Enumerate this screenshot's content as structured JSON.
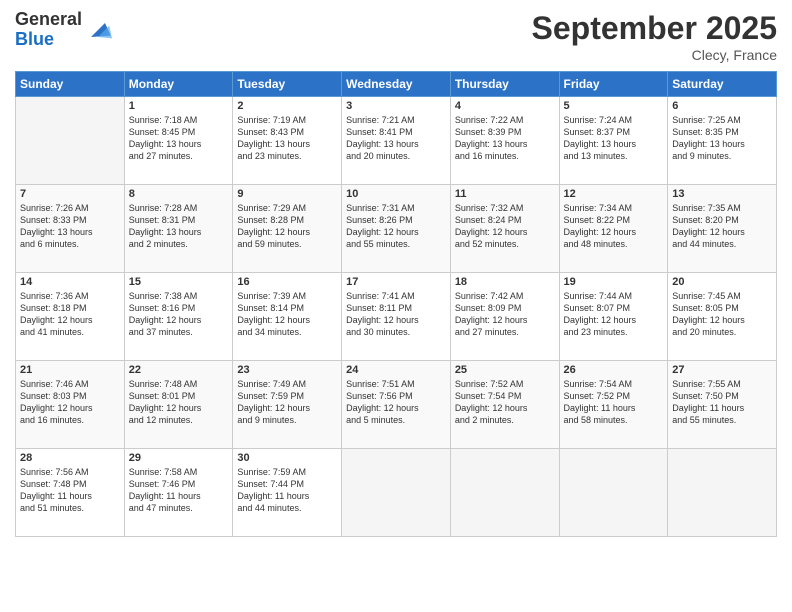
{
  "logo": {
    "general": "General",
    "blue": "Blue"
  },
  "header": {
    "month": "September 2025",
    "location": "Clecy, France"
  },
  "weekdays": [
    "Sunday",
    "Monday",
    "Tuesday",
    "Wednesday",
    "Thursday",
    "Friday",
    "Saturday"
  ],
  "weeks": [
    [
      {
        "day": "",
        "info": ""
      },
      {
        "day": "1",
        "info": "Sunrise: 7:18 AM\nSunset: 8:45 PM\nDaylight: 13 hours\nand 27 minutes."
      },
      {
        "day": "2",
        "info": "Sunrise: 7:19 AM\nSunset: 8:43 PM\nDaylight: 13 hours\nand 23 minutes."
      },
      {
        "day": "3",
        "info": "Sunrise: 7:21 AM\nSunset: 8:41 PM\nDaylight: 13 hours\nand 20 minutes."
      },
      {
        "day": "4",
        "info": "Sunrise: 7:22 AM\nSunset: 8:39 PM\nDaylight: 13 hours\nand 16 minutes."
      },
      {
        "day": "5",
        "info": "Sunrise: 7:24 AM\nSunset: 8:37 PM\nDaylight: 13 hours\nand 13 minutes."
      },
      {
        "day": "6",
        "info": "Sunrise: 7:25 AM\nSunset: 8:35 PM\nDaylight: 13 hours\nand 9 minutes."
      }
    ],
    [
      {
        "day": "7",
        "info": "Sunrise: 7:26 AM\nSunset: 8:33 PM\nDaylight: 13 hours\nand 6 minutes."
      },
      {
        "day": "8",
        "info": "Sunrise: 7:28 AM\nSunset: 8:31 PM\nDaylight: 13 hours\nand 2 minutes."
      },
      {
        "day": "9",
        "info": "Sunrise: 7:29 AM\nSunset: 8:28 PM\nDaylight: 12 hours\nand 59 minutes."
      },
      {
        "day": "10",
        "info": "Sunrise: 7:31 AM\nSunset: 8:26 PM\nDaylight: 12 hours\nand 55 minutes."
      },
      {
        "day": "11",
        "info": "Sunrise: 7:32 AM\nSunset: 8:24 PM\nDaylight: 12 hours\nand 52 minutes."
      },
      {
        "day": "12",
        "info": "Sunrise: 7:34 AM\nSunset: 8:22 PM\nDaylight: 12 hours\nand 48 minutes."
      },
      {
        "day": "13",
        "info": "Sunrise: 7:35 AM\nSunset: 8:20 PM\nDaylight: 12 hours\nand 44 minutes."
      }
    ],
    [
      {
        "day": "14",
        "info": "Sunrise: 7:36 AM\nSunset: 8:18 PM\nDaylight: 12 hours\nand 41 minutes."
      },
      {
        "day": "15",
        "info": "Sunrise: 7:38 AM\nSunset: 8:16 PM\nDaylight: 12 hours\nand 37 minutes."
      },
      {
        "day": "16",
        "info": "Sunrise: 7:39 AM\nSunset: 8:14 PM\nDaylight: 12 hours\nand 34 minutes."
      },
      {
        "day": "17",
        "info": "Sunrise: 7:41 AM\nSunset: 8:11 PM\nDaylight: 12 hours\nand 30 minutes."
      },
      {
        "day": "18",
        "info": "Sunrise: 7:42 AM\nSunset: 8:09 PM\nDaylight: 12 hours\nand 27 minutes."
      },
      {
        "day": "19",
        "info": "Sunrise: 7:44 AM\nSunset: 8:07 PM\nDaylight: 12 hours\nand 23 minutes."
      },
      {
        "day": "20",
        "info": "Sunrise: 7:45 AM\nSunset: 8:05 PM\nDaylight: 12 hours\nand 20 minutes."
      }
    ],
    [
      {
        "day": "21",
        "info": "Sunrise: 7:46 AM\nSunset: 8:03 PM\nDaylight: 12 hours\nand 16 minutes."
      },
      {
        "day": "22",
        "info": "Sunrise: 7:48 AM\nSunset: 8:01 PM\nDaylight: 12 hours\nand 12 minutes."
      },
      {
        "day": "23",
        "info": "Sunrise: 7:49 AM\nSunset: 7:59 PM\nDaylight: 12 hours\nand 9 minutes."
      },
      {
        "day": "24",
        "info": "Sunrise: 7:51 AM\nSunset: 7:56 PM\nDaylight: 12 hours\nand 5 minutes."
      },
      {
        "day": "25",
        "info": "Sunrise: 7:52 AM\nSunset: 7:54 PM\nDaylight: 12 hours\nand 2 minutes."
      },
      {
        "day": "26",
        "info": "Sunrise: 7:54 AM\nSunset: 7:52 PM\nDaylight: 11 hours\nand 58 minutes."
      },
      {
        "day": "27",
        "info": "Sunrise: 7:55 AM\nSunset: 7:50 PM\nDaylight: 11 hours\nand 55 minutes."
      }
    ],
    [
      {
        "day": "28",
        "info": "Sunrise: 7:56 AM\nSunset: 7:48 PM\nDaylight: 11 hours\nand 51 minutes."
      },
      {
        "day": "29",
        "info": "Sunrise: 7:58 AM\nSunset: 7:46 PM\nDaylight: 11 hours\nand 47 minutes."
      },
      {
        "day": "30",
        "info": "Sunrise: 7:59 AM\nSunset: 7:44 PM\nDaylight: 11 hours\nand 44 minutes."
      },
      {
        "day": "",
        "info": ""
      },
      {
        "day": "",
        "info": ""
      },
      {
        "day": "",
        "info": ""
      },
      {
        "day": "",
        "info": ""
      }
    ]
  ]
}
